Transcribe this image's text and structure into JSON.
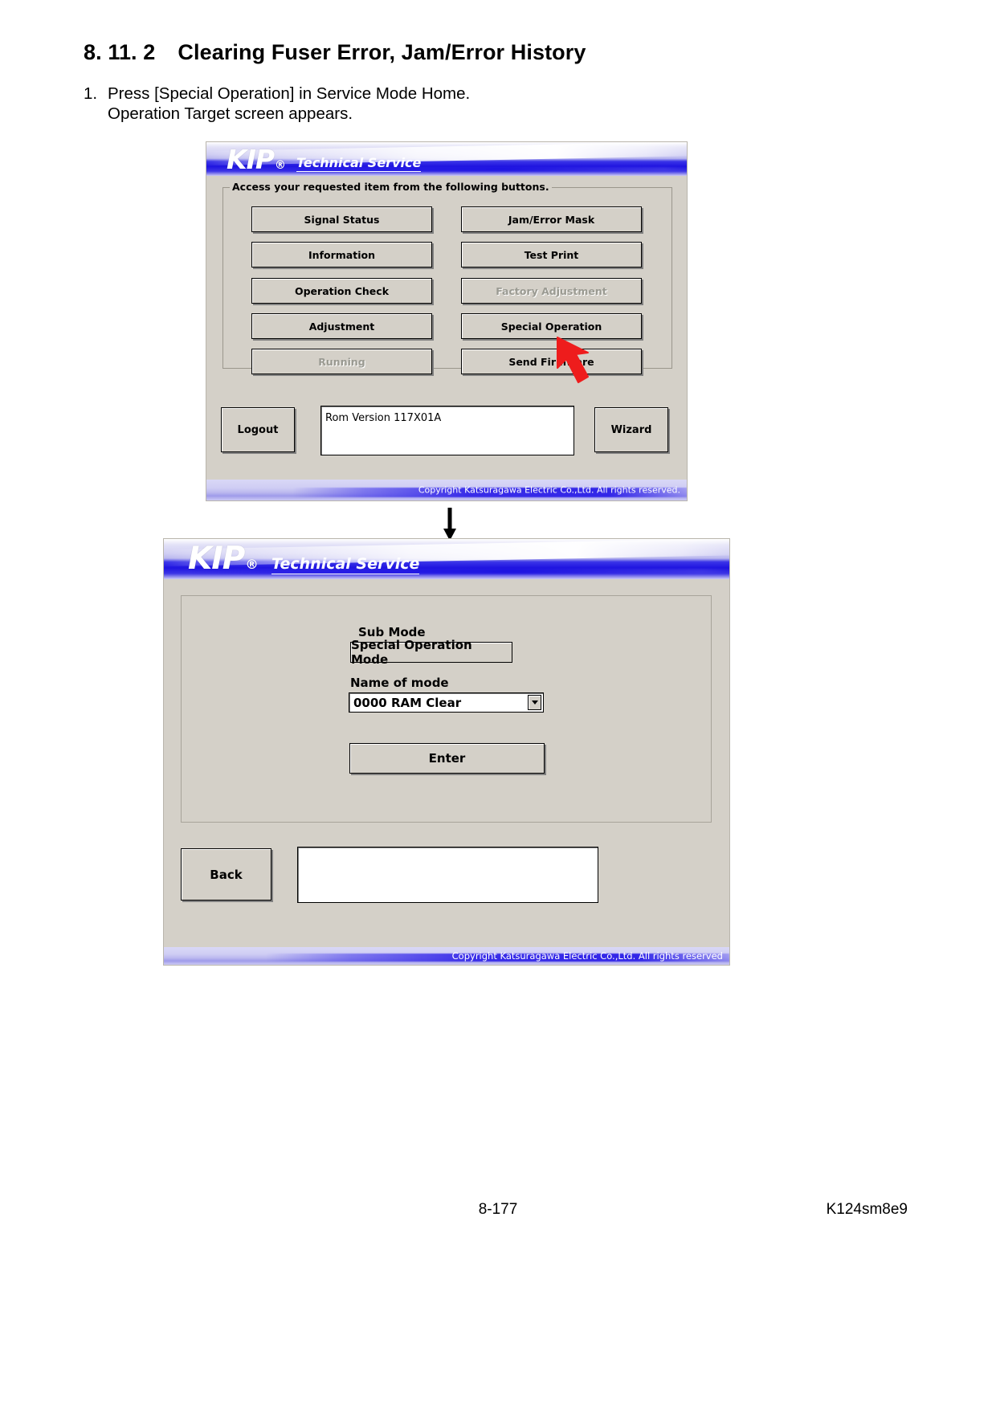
{
  "document": {
    "heading_number": "8. 11. 2",
    "heading_text": "Clearing Fuser Error, Jam/Error History",
    "step_number": "1.",
    "step_line1": "Press [Special Operation] in Service Mode Home.",
    "step_line2": "Operation Target screen appears.",
    "page_number": "8-177",
    "doc_code": "K124sm8e9"
  },
  "screen1": {
    "logo": "KIP",
    "logo_reg": "®",
    "subtitle": "Technical Service",
    "group_legend": "Access your requested item from the following buttons.",
    "buttons": [
      {
        "label": "Signal Status",
        "disabled": false
      },
      {
        "label": "Jam/Error Mask",
        "disabled": false
      },
      {
        "label": "Information",
        "disabled": false
      },
      {
        "label": "Test Print",
        "disabled": false
      },
      {
        "label": "Operation Check",
        "disabled": false
      },
      {
        "label": "Factory Adjustment",
        "disabled": true
      },
      {
        "label": "Adjustment",
        "disabled": false
      },
      {
        "label": "Special Operation",
        "disabled": false
      },
      {
        "label": "Running",
        "disabled": true
      },
      {
        "label": "Send Firmware",
        "disabled": false
      }
    ],
    "logout_label": "Logout",
    "wizard_label": "Wizard",
    "rom_version": "Rom Version 117X01A",
    "copyright": "Copyright Katsuragawa Electric Co.,Ltd. All rights reserved."
  },
  "screen2": {
    "logo": "KIP",
    "logo_reg": "®",
    "subtitle": "Technical Service",
    "sub_mode_label": "Sub Mode",
    "sub_mode_value": "Special Operation Mode",
    "name_of_mode_label": "Name of mode",
    "name_of_mode_value": "0000 RAM Clear",
    "enter_label": "Enter",
    "back_label": "Back",
    "message_box_value": "",
    "copyright": "Copyright Katsuragawa Electric Co.,Ltd. All rights reserved"
  },
  "annotations": {
    "pointer_color": "#ee1c1c",
    "flow_arrow_color": "#000000"
  }
}
